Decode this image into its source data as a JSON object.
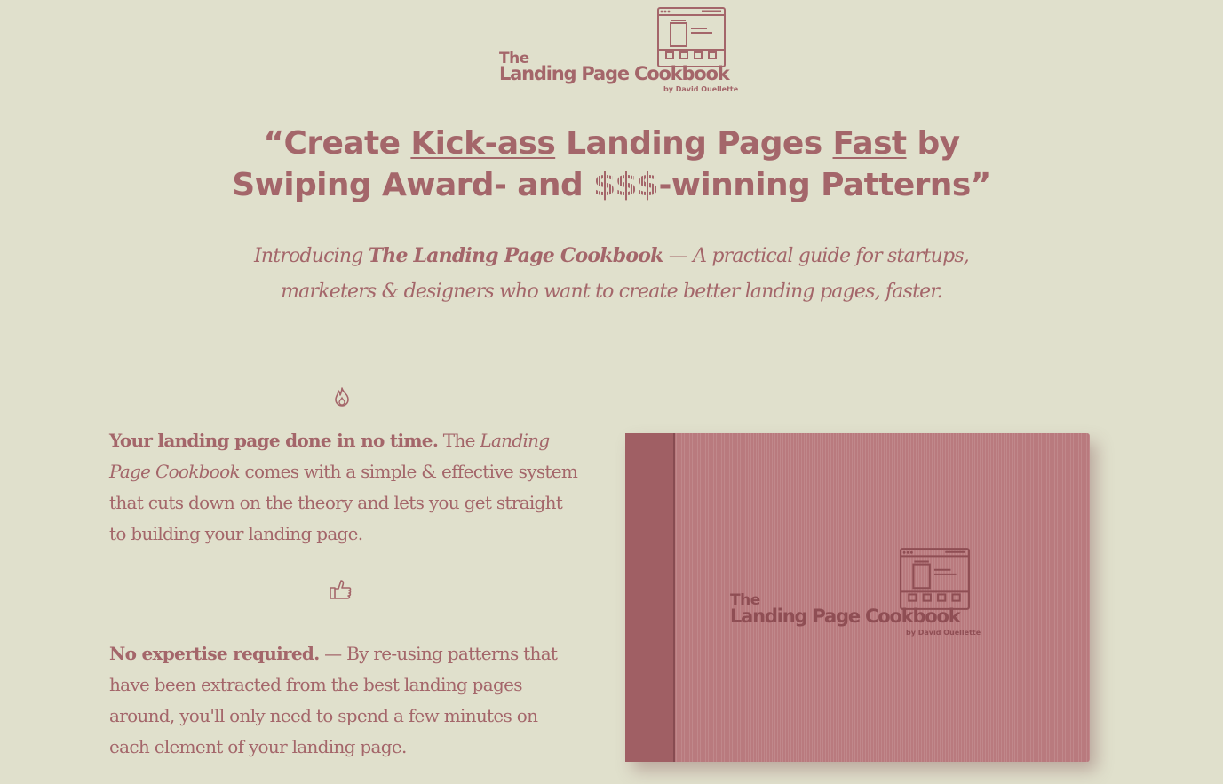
{
  "logo": {
    "the": "The",
    "title": "Landing Page Cookbook",
    "byline": "by David Ouellette",
    "icon": "browser-wireframe-icon"
  },
  "headline": {
    "quote_open": "“",
    "part1": "Create ",
    "kick_ass": "Kick-ass",
    "part2": " Landing Pages ",
    "fast": "Fast",
    "part3": " by",
    "part4": "Swiping Award- and ",
    "dollars": "$$$",
    "part5": "-winning Patterns",
    "quote_close": "”"
  },
  "subtitle": {
    "intro": "Introducing ",
    "book_name": "The Landing Page Cookbook",
    "rest_line1": " — A practical guide for startups,",
    "line2": "marketers & designers who want to create better landing pages, faster."
  },
  "features": [
    {
      "icon": "fire-icon",
      "bold": "Your landing page done in no time.",
      "pre": " The ",
      "italic": "Landing Page Cookbook",
      "rest": " comes with a simple & effective system that cuts down on the theory and lets you get straight to building your landing page."
    },
    {
      "icon": "thumbs-up-icon",
      "bold": "No expertise required.",
      "rest": " — By re-using patterns that have been extracted from the best landing pages around, you'll only need to spend a few minutes on each element of your landing page."
    }
  ],
  "book": {
    "the": "The",
    "title": "Landing Page Cookbook",
    "byline": "by David Ouellette"
  },
  "colors": {
    "background": "#e0e0cc",
    "text": "#a4666a",
    "book_cover": "#b97a7e",
    "book_spine": "#a05f64"
  }
}
